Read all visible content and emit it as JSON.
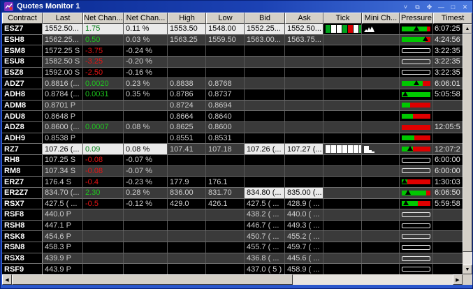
{
  "window": {
    "title": "Quotes Monitor 1",
    "controls": [
      {
        "name": "roll-up",
        "glyph": "˅"
      },
      {
        "name": "cascade",
        "glyph": "⧉"
      },
      {
        "name": "move",
        "glyph": "✥"
      },
      {
        "name": "minimize",
        "glyph": "—"
      },
      {
        "name": "maximize",
        "glyph": "□"
      },
      {
        "name": "close",
        "glyph": "✕"
      }
    ]
  },
  "colors": {
    "up_green": "#1ec81e",
    "down_red": "#e61414",
    "flash_bg": "#eaeaea",
    "tick_green": "#00a51e",
    "tick_red": "#d40000",
    "tick_white": "#ffffff",
    "pressure_green": "#00c800",
    "pressure_red": "#e00000"
  },
  "mini_shapes": {
    "m1": "0,11 3,7 5,9 7,4 9,8 11,3 13,6 15,11",
    "m2": "0,1 7,1 7,7 11,7 11,9 15,9 15,11 0,11"
  },
  "table": {
    "columns": [
      {
        "key": "contract",
        "label": "Contract"
      },
      {
        "key": "last",
        "label": "Last"
      },
      {
        "key": "net",
        "label": "Net Chan..."
      },
      {
        "key": "pct",
        "label": "Net Chan..."
      },
      {
        "key": "high",
        "label": "High"
      },
      {
        "key": "low",
        "label": "Low"
      },
      {
        "key": "bid",
        "label": "Bid"
      },
      {
        "key": "ask",
        "label": "Ask"
      },
      {
        "key": "tick",
        "label": "Tick"
      },
      {
        "key": "mini",
        "label": "Mini Ch..."
      },
      {
        "key": "pressure",
        "label": "Pressure"
      },
      {
        "key": "time",
        "label": "Timest"
      }
    ],
    "rows": [
      {
        "contract": "ESZ7",
        "last": "1552.50...",
        "net": "1.75",
        "dir": "up",
        "pct": "0.11 %",
        "high": "1553.50",
        "low": "1548.00",
        "bid": "1552.25...",
        "ask": "1552.50...",
        "tick": [
          "green",
          "white",
          "white",
          "green",
          "red",
          "white",
          "green"
        ],
        "mini": "m1",
        "pressure": {
          "green": 88,
          "marker": 52
        },
        "time": "6:07:25",
        "flash": [
          "last",
          "net",
          "pct",
          "high",
          "low",
          "bid",
          "ask"
        ]
      },
      {
        "contract": "ESH8",
        "last": "1562.25...",
        "net": "0.50",
        "dir": "up",
        "pct": "0.03 %",
        "high": "1563.25",
        "low": "1559.50",
        "bid": "1563.00...",
        "ask": "1563.75...",
        "tick": [],
        "mini": null,
        "pressure": {
          "green": 82,
          "marker": 84
        },
        "time": "4:24:56",
        "flash": []
      },
      {
        "contract": "ESM8",
        "last": "1572.25 S",
        "net": "-3.75",
        "dir": "down",
        "pct": "-0.24 %",
        "high": "",
        "low": "",
        "bid": "",
        "ask": "",
        "tick": [],
        "mini": null,
        "pressure": null,
        "time": "3:22:35",
        "flash": []
      },
      {
        "contract": "ESU8",
        "last": "1582.50 S",
        "net": "-3.25",
        "dir": "down",
        "pct": "-0.20 %",
        "high": "",
        "low": "",
        "bid": "",
        "ask": "",
        "tick": [],
        "mini": null,
        "pressure": null,
        "time": "3:22:35",
        "flash": []
      },
      {
        "contract": "ESZ8",
        "last": "1592.00 S",
        "net": "-2.50",
        "dir": "down",
        "pct": "-0.16 %",
        "high": "",
        "low": "",
        "bid": "",
        "ask": "",
        "tick": [],
        "mini": null,
        "pressure": null,
        "time": "3:22:35",
        "flash": []
      },
      {
        "contract": "ADZ7",
        "last": "0.8816 (...",
        "net": "0.0020",
        "dir": "up",
        "pct": "0.23 %",
        "high": "0.8838",
        "low": "0.8768",
        "bid": "",
        "ask": "",
        "tick": [],
        "mini": null,
        "pressure": {
          "green": 74,
          "marker": 50
        },
        "time": "6:06:01",
        "flash": []
      },
      {
        "contract": "ADH8",
        "last": "0.8784 (...",
        "net": "0.0031",
        "dir": "up",
        "pct": "0.35 %",
        "high": "0.8786",
        "low": "0.8737",
        "bid": "",
        "ask": "",
        "tick": [],
        "mini": null,
        "pressure": {
          "green": 100,
          "marker": 12
        },
        "time": "5:05:58",
        "flash": []
      },
      {
        "contract": "ADM8",
        "last": "0.8701 P",
        "net": "",
        "dir": null,
        "pct": "",
        "high": "0.8724",
        "low": "0.8694",
        "bid": "",
        "ask": "",
        "tick": [],
        "mini": null,
        "pressure": {
          "green": 30,
          "marker": null
        },
        "time": "",
        "flash": []
      },
      {
        "contract": "ADU8",
        "last": "0.8648 P",
        "net": "",
        "dir": null,
        "pct": "",
        "high": "0.8664",
        "low": "0.8640",
        "bid": "",
        "ask": "",
        "tick": [],
        "mini": null,
        "pressure": {
          "green": 40,
          "marker": null
        },
        "time": "",
        "flash": []
      },
      {
        "contract": "ADZ8",
        "last": "0.8600 (...",
        "net": "0.0007",
        "dir": "up",
        "pct": "0.08 %",
        "high": "0.8625",
        "low": "0.8600",
        "bid": "",
        "ask": "",
        "tick": [],
        "mini": null,
        "pressure": {
          "green": 0,
          "marker": null
        },
        "time": "12:05:5",
        "flash": []
      },
      {
        "contract": "ADH9",
        "last": "0.8538 P",
        "net": "",
        "dir": null,
        "pct": "",
        "high": "0.8551",
        "low": "0.8531",
        "bid": "",
        "ask": "",
        "tick": [],
        "mini": null,
        "pressure": {
          "green": 45,
          "marker": null
        },
        "time": "",
        "flash": []
      },
      {
        "contract": "RZ7",
        "last": "107.26 (...",
        "net": "0.09",
        "dir": "up",
        "pct": "0.08 %",
        "high": "107.41",
        "low": "107.18",
        "bid": "107.26 (...",
        "ask": "107.27 (...",
        "tick": [
          "white",
          "white",
          "white",
          "white",
          "white",
          "white",
          "white"
        ],
        "mini": "m2",
        "pressure": {
          "green": 38,
          "marker": 30
        },
        "time": "12:07:2",
        "flash": [
          "last",
          "net",
          "pct",
          "bid",
          "ask"
        ]
      },
      {
        "contract": "RH8",
        "last": "107.25 S",
        "net": "-0.08",
        "dir": "down",
        "pct": "-0.07 %",
        "high": "",
        "low": "",
        "bid": "",
        "ask": "",
        "tick": [],
        "mini": null,
        "pressure": null,
        "time": "6:00:00",
        "flash": []
      },
      {
        "contract": "RM8",
        "last": "107.34 S",
        "net": "-0.08",
        "dir": "down",
        "pct": "-0.07 %",
        "high": "",
        "low": "",
        "bid": "",
        "ask": "",
        "tick": [],
        "mini": null,
        "pressure": null,
        "time": "6:00:00",
        "flash": []
      },
      {
        "contract": "ERZ7",
        "last": "176.4 S",
        "net": "-0.4",
        "dir": "down",
        "pct": "-0.23 %",
        "high": "177.9",
        "low": "176.1",
        "bid": "",
        "ask": "",
        "tick": [],
        "mini": null,
        "pressure": {
          "green": 20,
          "marker": 10
        },
        "time": "1:30:03",
        "flash": []
      },
      {
        "contract": "ER2Z7",
        "last": "834.70 (...",
        "net": "2.30",
        "dir": "up",
        "pct": "0.28 %",
        "high": "836.00",
        "low": "831.70",
        "bid": "834.80 (...",
        "ask": "835.00 (...",
        "tick": [],
        "mini": null,
        "pressure": {
          "green": 85,
          "marker": 22
        },
        "time": "6:06:50",
        "flash": [
          "bid",
          "ask"
        ]
      },
      {
        "contract": "RSX7",
        "last": "427.5 ( ...",
        "net": "-0.5",
        "dir": "down",
        "pct": "-0.12 %",
        "high": "429.0",
        "low": "426.1",
        "bid": "427.5 ( ...",
        "ask": "428.9 ( ...",
        "tick": [],
        "mini": null,
        "pressure": {
          "green": 55,
          "marker": 15
        },
        "time": "5:59:58",
        "flash": []
      },
      {
        "contract": "RSF8",
        "last": "440.0 P",
        "net": "",
        "dir": null,
        "pct": "",
        "high": "",
        "low": "",
        "bid": "438.2 ( ...",
        "ask": "440.0 ( ...",
        "tick": [],
        "mini": null,
        "pressure": null,
        "time": "",
        "flash": []
      },
      {
        "contract": "RSH8",
        "last": "447.1 P",
        "net": "",
        "dir": null,
        "pct": "",
        "high": "",
        "low": "",
        "bid": "446.7 ( ...",
        "ask": "449.3 ( ...",
        "tick": [],
        "mini": null,
        "pressure": null,
        "time": "",
        "flash": []
      },
      {
        "contract": "RSK8",
        "last": "454.6 P",
        "net": "",
        "dir": null,
        "pct": "",
        "high": "",
        "low": "",
        "bid": "450.7 ( ...",
        "ask": "455.2 ( ...",
        "tick": [],
        "mini": null,
        "pressure": null,
        "time": "",
        "flash": []
      },
      {
        "contract": "RSN8",
        "last": "458.3 P",
        "net": "",
        "dir": null,
        "pct": "",
        "high": "",
        "low": "",
        "bid": "455.7 ( ...",
        "ask": "459.7 ( ...",
        "tick": [],
        "mini": null,
        "pressure": null,
        "time": "",
        "flash": []
      },
      {
        "contract": "RSX8",
        "last": "439.9 P",
        "net": "",
        "dir": null,
        "pct": "",
        "high": "",
        "low": "",
        "bid": "436.8 ( ...",
        "ask": "445.6 ( ...",
        "tick": [],
        "mini": null,
        "pressure": null,
        "time": "",
        "flash": []
      },
      {
        "contract": "RSF9",
        "last": "443.9 P",
        "net": "",
        "dir": null,
        "pct": "",
        "high": "",
        "low": "",
        "bid": "437.0 ( 5 )",
        "ask": "458.9 ( ...",
        "tick": [],
        "mini": null,
        "pressure": null,
        "time": "",
        "flash": []
      }
    ]
  }
}
